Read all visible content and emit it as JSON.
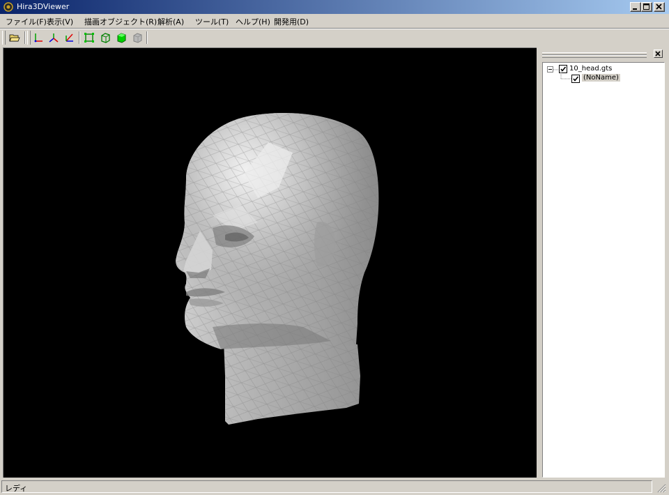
{
  "window": {
    "title": "Hira3DViewer"
  },
  "menu": {
    "items": [
      {
        "label": "ファイル(F)"
      },
      {
        "label": "表示(V)"
      },
      {
        "label": "描画オブジェクト(R)"
      },
      {
        "label": "解析(A)"
      },
      {
        "label": "ツール(T)"
      },
      {
        "label": "ヘルプ(H)"
      },
      {
        "label": "開発用(D)"
      }
    ]
  },
  "toolbar": {
    "buttons": [
      {
        "name": "open-folder-icon"
      },
      {
        "name": "axis-xy-icon"
      },
      {
        "name": "axis-yz-icon"
      },
      {
        "name": "axis-zx-icon"
      },
      {
        "name": "fit-view-icon"
      },
      {
        "name": "wireframe-icon"
      },
      {
        "name": "solid-shading-icon"
      },
      {
        "name": "disabled-shading-icon"
      }
    ]
  },
  "viewport": {
    "background": "#000000",
    "model_color": "#a9a9a9"
  },
  "object_tree": {
    "root": {
      "label": "10_head.gts",
      "checked": true,
      "expanded": true
    },
    "children": [
      {
        "label": "(NoName)",
        "checked": true,
        "selected": true
      }
    ]
  },
  "statusbar": {
    "text": "レディ"
  }
}
